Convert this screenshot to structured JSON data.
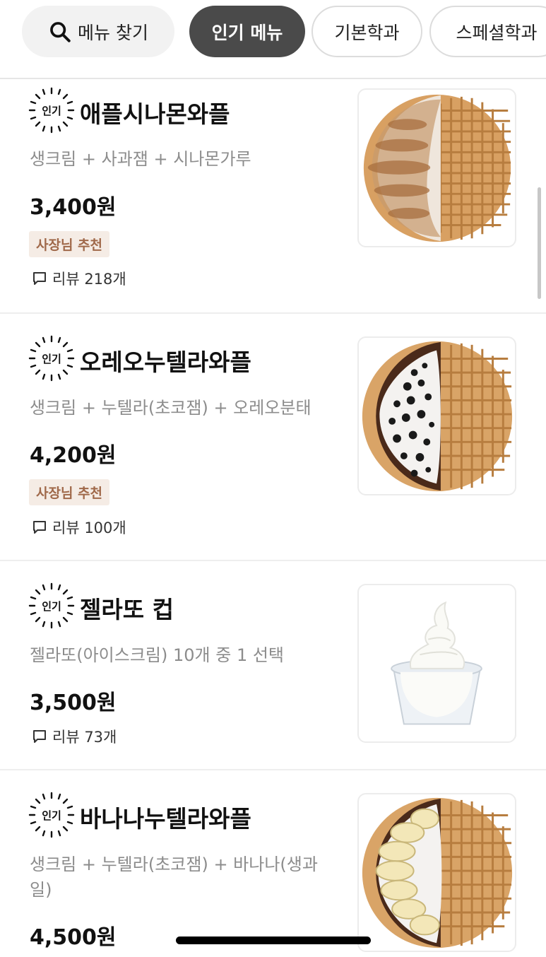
{
  "topbar": {
    "search_label": "메뉴 찾기",
    "categories": [
      "인기 메뉴",
      "기본학과",
      "스페셜학과"
    ]
  },
  "badge_label": "인기",
  "items": [
    {
      "name": "애플시나몬와플",
      "description": "생크림 + 사과잼 + 시나몬가루",
      "price": "3,400원",
      "tag": "사장님 추천",
      "reviews": "리뷰 218개"
    },
    {
      "name": "오레오누텔라와플",
      "description": "생크림 + 누텔라(초코잼) + 오레오분태",
      "price": "4,200원",
      "tag": "사장님 추천",
      "reviews": "리뷰 100개"
    },
    {
      "name": "젤라또 컵",
      "description": "젤라또(아이스크림) 10개 중 1 선택",
      "price": "3,500원",
      "reviews": "리뷰 73개"
    },
    {
      "name": "바나나누텔라와플",
      "description": "생크림 + 누텔라(초코잼) + 바나나(생과일)",
      "price": "4,500원"
    }
  ],
  "colors": {
    "active_chip": "#4a4a4a",
    "tag_bg": "#f5ece5",
    "tag_text": "#a0694a",
    "desc_text": "#8c8c8c"
  }
}
